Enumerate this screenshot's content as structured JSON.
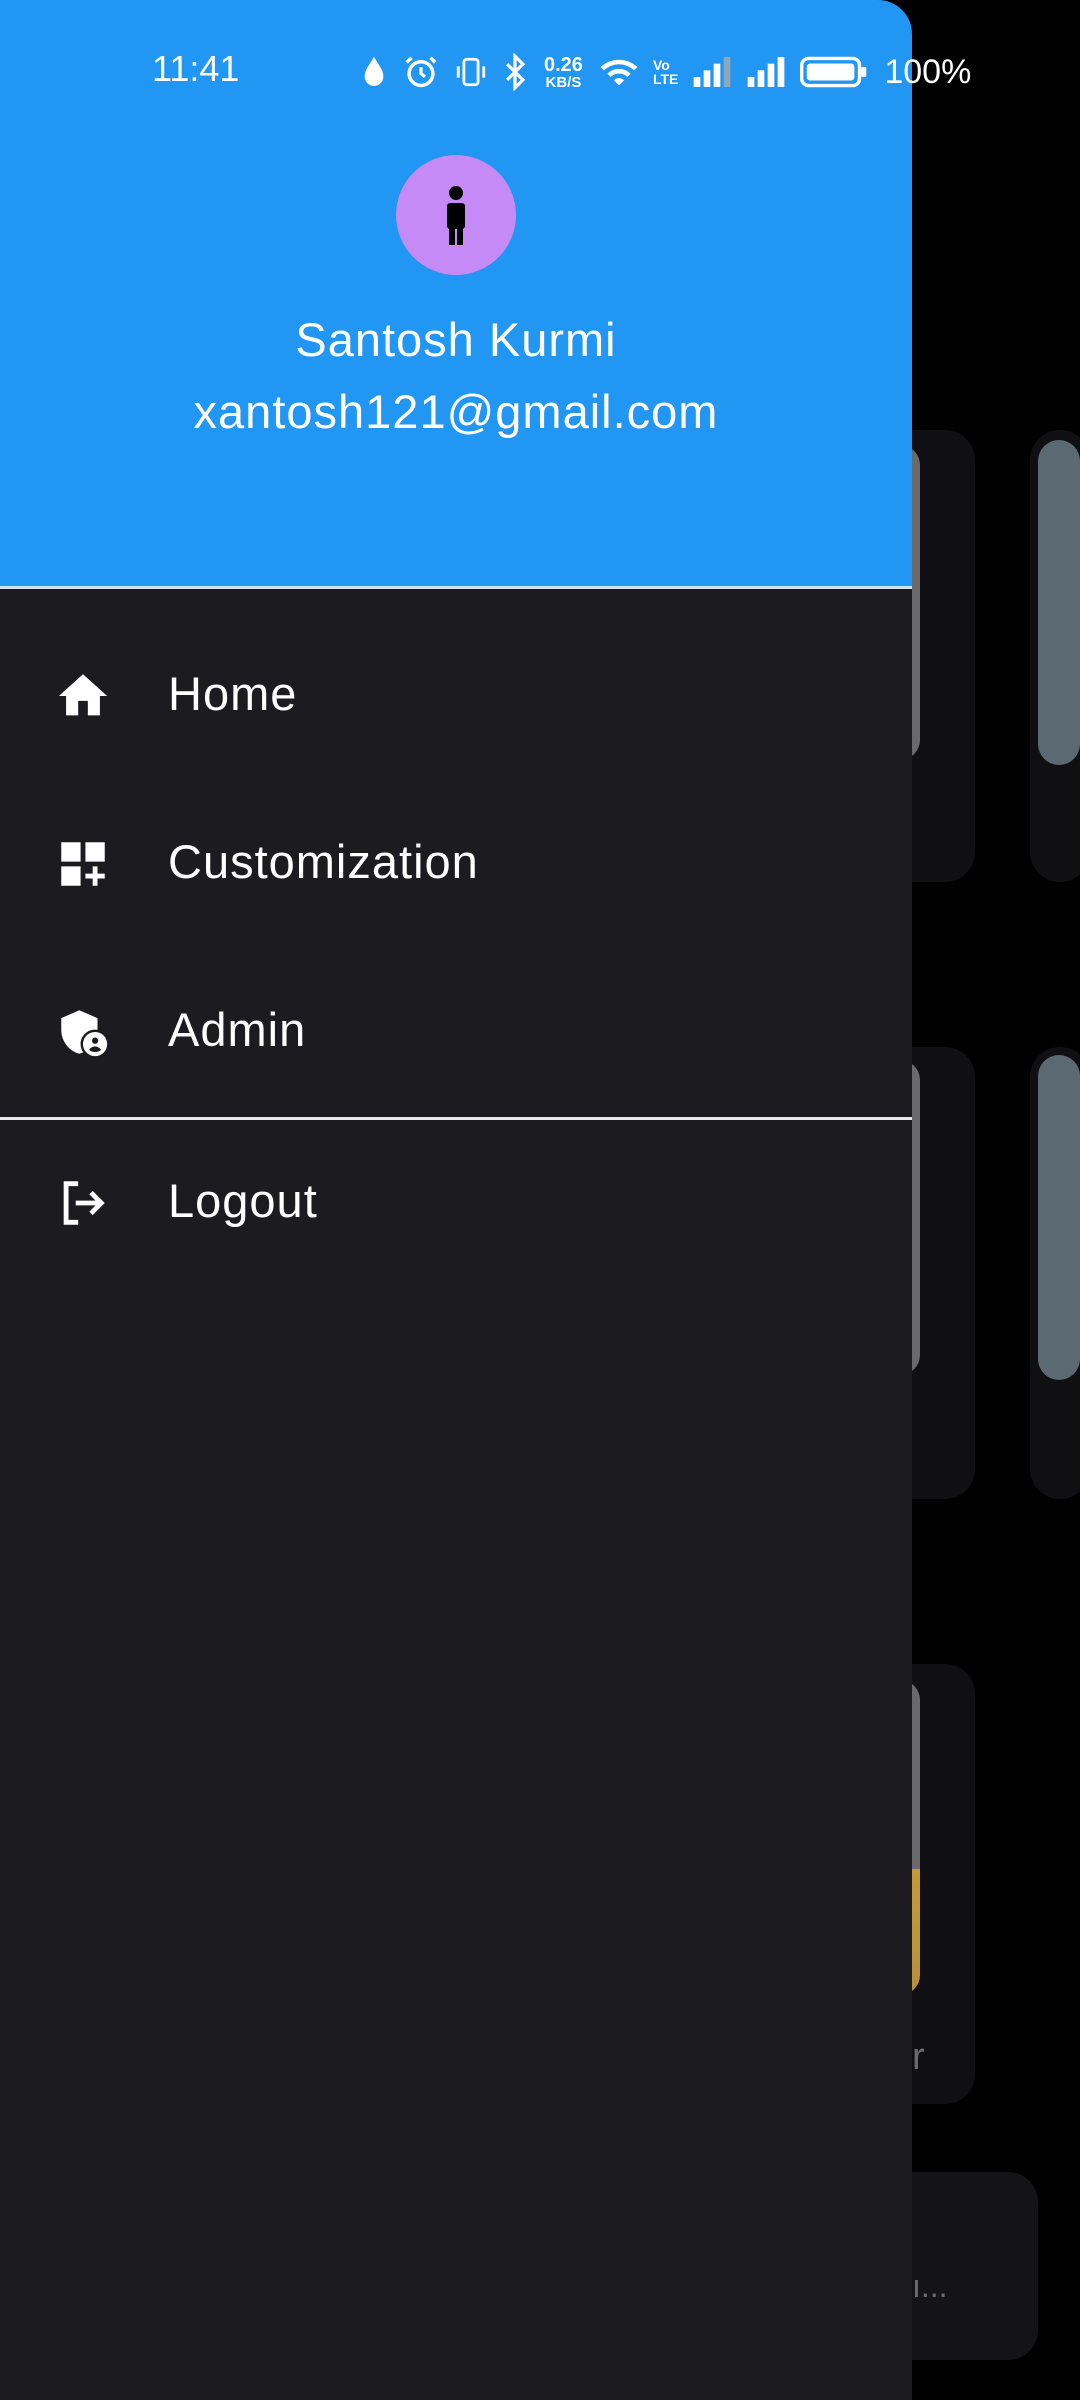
{
  "status_bar": {
    "time": "11:41",
    "net_speed_value": "0.26",
    "net_speed_unit": "KB/S",
    "volte_top": "Vo",
    "volte_bottom": "LTE",
    "battery_percent": "100%"
  },
  "drawer": {
    "user": {
      "name": "Santosh Kurmi",
      "email": "xantosh121@gmail.com"
    },
    "menu_items": [
      {
        "label": "Home",
        "icon": "home-icon"
      },
      {
        "label": "Customization",
        "icon": "dashboard-customize-icon"
      },
      {
        "label": "Admin",
        "icon": "admin-shield-icon"
      }
    ],
    "logout_label": "Logout"
  },
  "background": {
    "peek_text_1": "r",
    "peek_text_2": "ı..."
  },
  "colors": {
    "header": "#2196f3",
    "drawer_bg": "#1c1b1f",
    "avatar": "#c58af5"
  }
}
